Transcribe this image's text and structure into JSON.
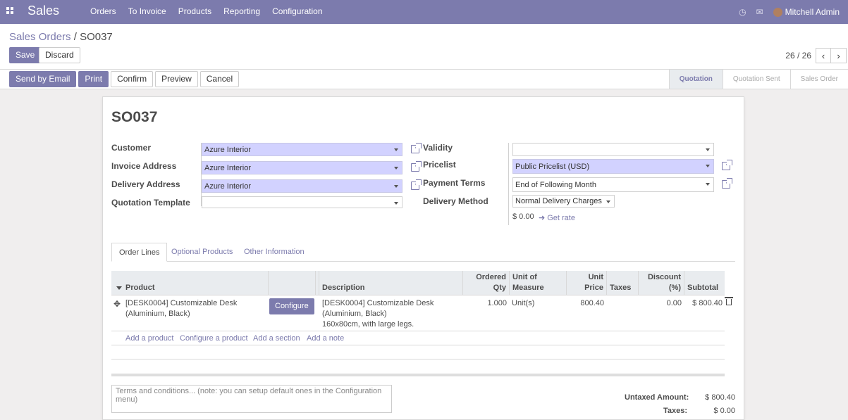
{
  "topbar": {
    "app_title": "Sales",
    "menu": [
      "Orders",
      "To Invoice",
      "Products",
      "Reporting",
      "Configuration"
    ],
    "user_name": "Mitchell Admin",
    "icons": [
      "apps-icon",
      "clock-icon",
      "chat-icon",
      "avatar"
    ]
  },
  "control": {
    "breadcrumb_parent": "Sales Orders",
    "breadcrumb_sep": "/",
    "breadcrumb_current": "SO037",
    "save_label": "Save",
    "discard_label": "Discard",
    "pager_value": "26 / 26"
  },
  "statusbar": {
    "buttons": [
      "Send by Email",
      "Print",
      "Confirm",
      "Preview",
      "Cancel"
    ],
    "stages": [
      "Quotation",
      "Quotation Sent",
      "Sales Order"
    ],
    "active_stage": "Quotation"
  },
  "form": {
    "title": "SO037",
    "customer_label": "Customer",
    "customer_value": "Azure Interior",
    "invoice_address_label": "Invoice Address",
    "invoice_address_value": "Azure Interior",
    "delivery_address_label": "Delivery Address",
    "delivery_address_value": "Azure Interior",
    "quotation_template_label": "Quotation Template",
    "quotation_template_value": "",
    "validity_label": "Validity",
    "validity_value": "",
    "pricelist_label": "Pricelist",
    "pricelist_value": "Public Pricelist (USD)",
    "payment_terms_label": "Payment Terms",
    "payment_terms_value": "End of Following Month",
    "delivery_method_label": "Delivery Method",
    "delivery_method_value": "Normal Delivery Charges",
    "delivery_amount": "$ 0.00",
    "get_rate_label": "Get rate"
  },
  "tabs": [
    "Order Lines",
    "Optional Products",
    "Other Information"
  ],
  "order_lines": {
    "headers": {
      "product": "Product",
      "description": "Description",
      "ordered_qty_1": "Ordered",
      "ordered_qty_2": "Qty",
      "uom_1": "Unit of",
      "uom_2": "Measure",
      "unit_price_1": "Unit",
      "unit_price_2": "Price",
      "taxes": "Taxes",
      "discount_1": "Discount",
      "discount_2": "(%)",
      "subtotal": "Subtotal"
    },
    "rows": [
      {
        "product_1": "[DESK0004] Customizable Desk",
        "product_2": "(Aluminium, Black)",
        "configure_label": "Configure",
        "description_1": "[DESK0004] Customizable Desk",
        "description_2": "(Aluminium, Black)",
        "description_3": "160x80cm, with large legs.",
        "qty": "1.000",
        "uom": "Unit(s)",
        "unit_price": "800.40",
        "taxes": "",
        "discount": "0.00",
        "subtotal": "$ 800.40"
      }
    ],
    "add_links": [
      "Add a product",
      "Configure a product",
      "Add a section",
      "Add a note"
    ]
  },
  "footer": {
    "terms_placeholder": "Terms and conditions... (note: you can setup default ones in the Configuration menu)",
    "untaxed_label": "Untaxed Amount:",
    "untaxed_value": "$ 800.40",
    "taxes_label": "Taxes:",
    "taxes_value": "$ 0.00"
  },
  "colors": {
    "brand": "#7c7bad",
    "required_field_bg": "#d2d2ff"
  }
}
